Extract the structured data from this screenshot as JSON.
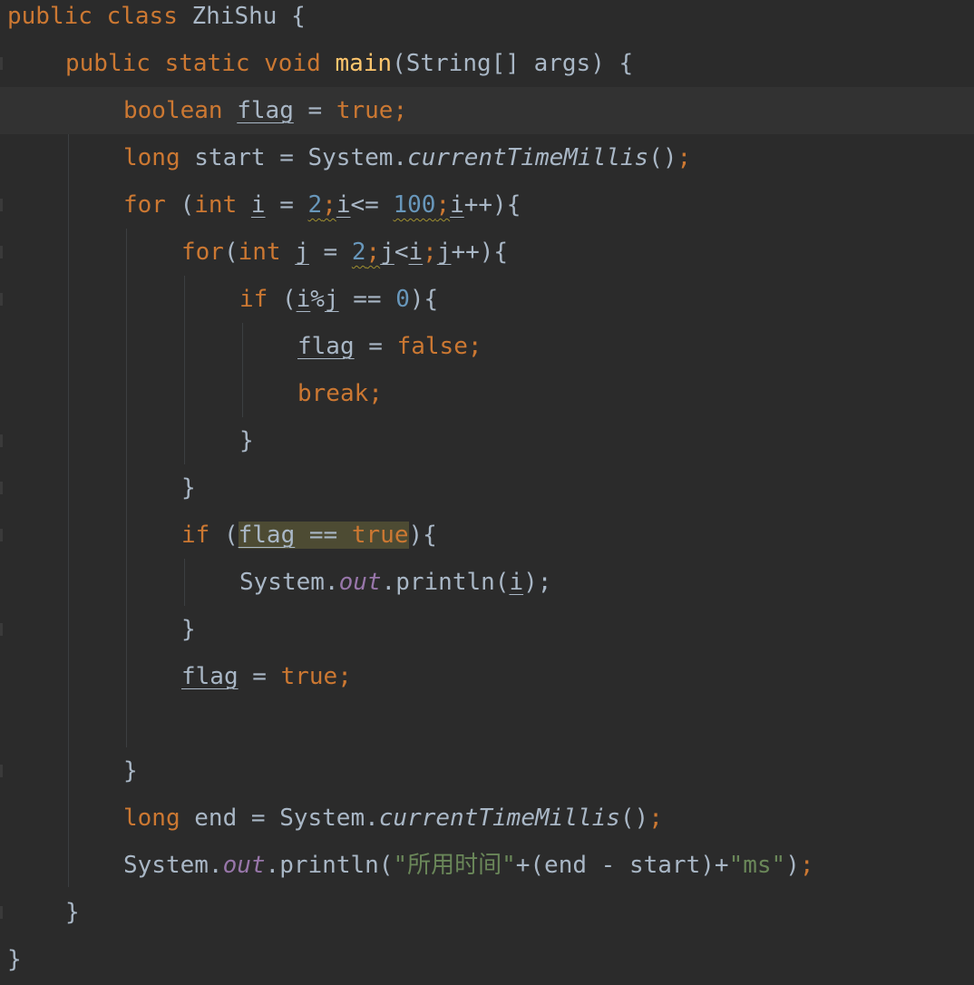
{
  "code": {
    "l1": {
      "kw1": "public",
      "kw2": "class",
      "cls": "ZhiShu",
      "brace": "{"
    },
    "l2": {
      "kw1": "public",
      "kw2": "static",
      "kw3": "void",
      "fn": "main",
      "params": "(String[] args) {"
    },
    "l3": {
      "type": "boolean",
      "var": "flag",
      "eq": " = ",
      "val": "true",
      "semi": ";"
    },
    "l4": {
      "type": "long",
      "rest": " start = System.",
      "call": "currentTimeMillis",
      "paren": "()",
      "semi": ";"
    },
    "l5": {
      "kw": "for",
      "p1": " (",
      "type": "int",
      "sp": " ",
      "i1": "i",
      "eq": " = ",
      "n2": "2",
      "semi1": ";",
      "i2": "i",
      "le": "<= ",
      "n100": "100",
      "semi2": ";",
      "i3": "i",
      "tail": "++){"
    },
    "l6": {
      "kw": "for",
      "p1": "(",
      "type": "int",
      "sp": " ",
      "j1": "j",
      "eq": " = ",
      "n2": "2",
      "semi1": ";",
      "j2": "j",
      "lt": "<",
      "i": "i",
      "semi2": ";",
      "j3": "j",
      "tail": "++){"
    },
    "l7": {
      "kw": "if",
      "p1": " (",
      "i": "i",
      "mod": "%",
      "j": "j",
      "eq": " == ",
      "zero": "0",
      "tail": "){"
    },
    "l8": {
      "var": "flag",
      "eq": " = ",
      "val": "false",
      "semi": ";"
    },
    "l9": {
      "kw": "break",
      "semi": ";"
    },
    "l10": {
      "brace": "}"
    },
    "l11": {
      "brace": "}"
    },
    "l12": {
      "kw": "if",
      "p1": " (",
      "var": "flag",
      "eq": " == ",
      "val": "true",
      "tail": "){"
    },
    "l13": {
      "sys": "System.",
      "out": "out",
      "call": ".println(",
      "i": "i",
      "tail": ");"
    },
    "l14": {
      "brace": "}"
    },
    "l15": {
      "var": "flag",
      "eq": " = ",
      "val": "true",
      "semi": ";"
    },
    "l17": {
      "brace": "}"
    },
    "l18": {
      "type": "long",
      "rest": " end = System.",
      "call": "currentTimeMillis",
      "paren": "()",
      "semi": ";"
    },
    "l19": {
      "sys": "System.",
      "out": "out",
      "call": ".println(",
      "s1": "\"所用时间\"",
      "mid": "+(end - start)+",
      "s2": "\"ms\"",
      "tail": ")",
      "semi": ";"
    },
    "l20": {
      "brace": "}"
    },
    "l21": {
      "brace": "}"
    }
  },
  "colors": {
    "background": "#2b2b2b",
    "current_line": "#323232",
    "keyword": "#cc7832",
    "function": "#ffc66d",
    "number": "#6897bb",
    "string": "#6a8759",
    "field": "#9876aa",
    "default": "#a9b7c6",
    "highlight": "#4d4b33"
  }
}
